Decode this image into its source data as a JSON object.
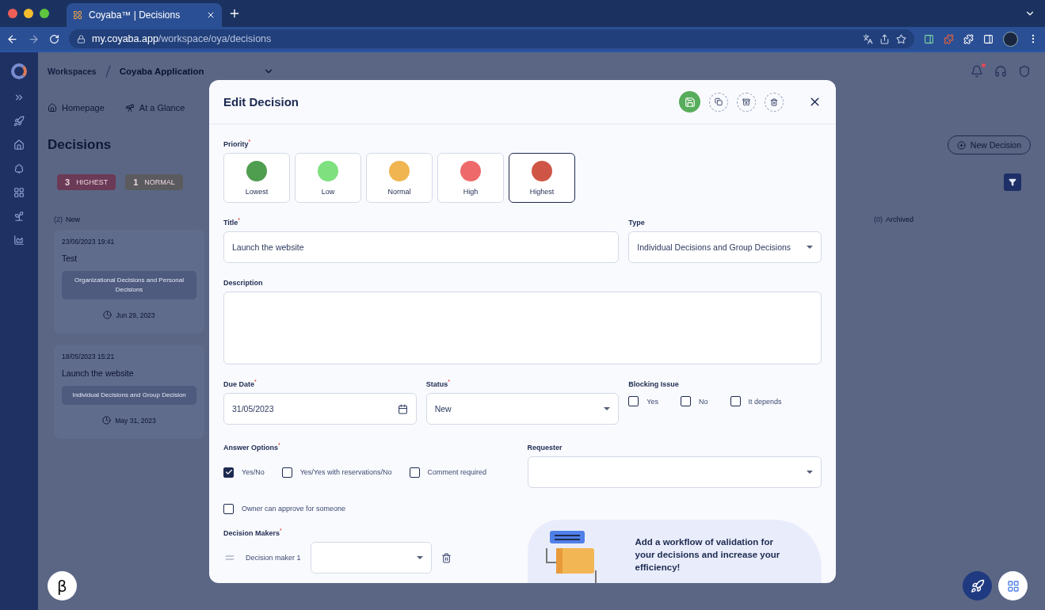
{
  "browser": {
    "tab_title": "Coyaba™ | Decisions",
    "url_host": "my.coyaba.app",
    "url_path": "/workspace/oya/decisions"
  },
  "app": {
    "breadcrumbs": [
      {
        "label": "Workspaces",
        "selected": false
      },
      {
        "label": "Coyaba Application",
        "selected": true
      }
    ],
    "nav": [
      {
        "kind": "home",
        "label": "Homepage"
      },
      {
        "kind": "telescope",
        "label": "At a Glance"
      }
    ],
    "page_title": "Decisions",
    "new_button": "New Decision",
    "filters": [
      {
        "count": "3",
        "label": "HIGHEST",
        "color": "#6b3a56"
      },
      {
        "count": "1",
        "label": "NORMAL",
        "color": "#5b5a5e"
      }
    ],
    "columns": [
      {
        "count": "(2)",
        "title": "New",
        "cards": [
          {
            "timestamp": "23/06/2023 19:41",
            "title": "Test",
            "tag": "Organizational Decisions and Personal Decisions",
            "due": "Jun 29, 2023"
          },
          {
            "timestamp": "18/05/2023 15:21",
            "title": "Launch the website",
            "tag": "Individual Decisions and Group Decision",
            "due": "May 31, 2023"
          }
        ]
      },
      {
        "count": "(0)",
        "title": "Archived"
      }
    ],
    "beta_button": "β"
  },
  "modal": {
    "title": "Edit Decision",
    "priority": {
      "label": "Priority$^{*}$",
      "options": [
        {
          "label": "Lowest",
          "color": "#4f9d4f",
          "selected": false
        },
        {
          "label": "Low",
          "color": "#7ee07e",
          "selected": false
        },
        {
          "label": "Normal",
          "color": "#f0b550",
          "selected": false
        },
        {
          "label": "High",
          "color": "#ee6a6a",
          "selected": false
        },
        {
          "label": "Highest",
          "color": "#cf5646",
          "selected": true
        }
      ]
    },
    "title_field": {
      "label": "Title$^{*}$",
      "value": "Launch the website"
    },
    "type_field": {
      "label": "Type",
      "value": "Individual Decisions and Group Decisions"
    },
    "description_field": {
      "label": "Description"
    },
    "due_date": {
      "label": "Due Date$^{*}$",
      "value": "31/05/2023"
    },
    "status": {
      "label": "Status$^{*}$",
      "value": "New"
    },
    "blocking_issue": {
      "label": "Blocking Issue",
      "options": [
        {
          "label": "Yes",
          "checked": false
        },
        {
          "label": "No",
          "checked": false
        },
        {
          "label": "It depends",
          "checked": false
        }
      ]
    },
    "answer_options": {
      "label": "Answer Options$^{*}$",
      "options": [
        {
          "label": "Yes/No",
          "checked": true
        },
        {
          "label": "Yes/Yes with reservations/No",
          "checked": false
        },
        {
          "label": "Comment required",
          "checked": false
        }
      ],
      "owner_option": {
        "label": "Owner can approve for someone",
        "checked": false
      }
    },
    "requester": {
      "label": "Requester"
    },
    "decision_makers": {
      "label": "Decision Makers$^{*}$",
      "rows": [
        {
          "label": "Decision maker 1"
        }
      ]
    },
    "promo": {
      "text": "Add a workflow of validation for your decisions and increase your efficiency!"
    }
  }
}
